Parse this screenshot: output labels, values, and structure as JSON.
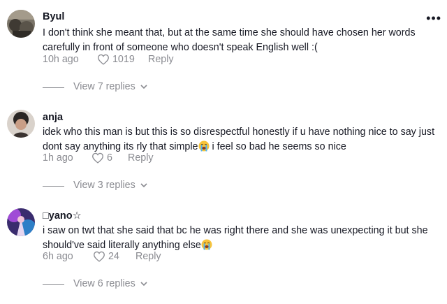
{
  "comments": [
    {
      "username": "Byul",
      "text": "I don't think she meant that, but at the same time she should have chosen her words carefully in front of someone who doesn't speak English well :(",
      "time": "10h ago",
      "likes": "1019",
      "reply_label": "Reply",
      "view_replies": "View 7 replies",
      "more_label": "•••"
    },
    {
      "username": "anja",
      "text_before_emoji": "idek who this man is but this is so disrespectful honestly if u have nothing nice to say just dont say anything its rly that simple",
      "text_after_emoji": " i feel so bad he seems so nice",
      "emoji": "loudly-crying-face",
      "time": "1h ago",
      "likes": "6",
      "reply_label": "Reply",
      "view_replies": "View 3 replies"
    },
    {
      "username": "□yano☆",
      "text_before_emoji": "i saw on twt that she said that bc he was right there and she was unexpecting it but she should've said literally anything else",
      "emoji": "loudly-crying-face",
      "time": "6h ago",
      "likes": "24",
      "reply_label": "Reply",
      "view_replies": "View 6 replies"
    }
  ],
  "colors": {
    "text": "#161823",
    "muted": "#8a8b91",
    "background": "#ffffff"
  }
}
